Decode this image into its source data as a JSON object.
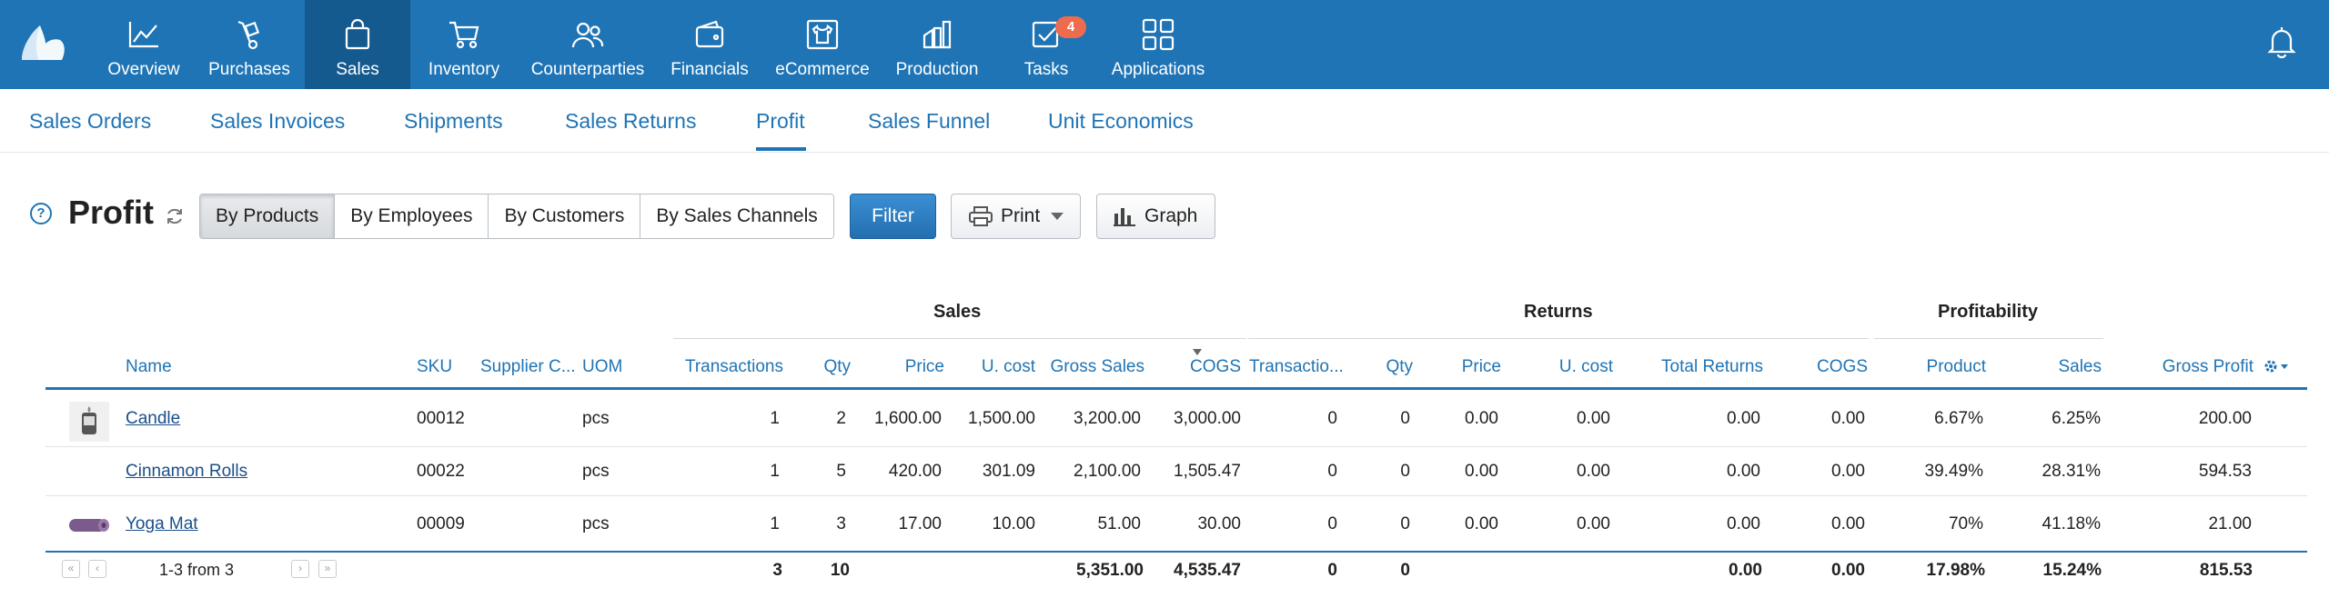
{
  "nav": {
    "items": [
      {
        "label": "Overview",
        "icon": "chart-line-icon"
      },
      {
        "label": "Purchases",
        "icon": "hand-truck-icon"
      },
      {
        "label": "Sales",
        "icon": "shopping-bag-icon",
        "active": true
      },
      {
        "label": "Inventory",
        "icon": "cart-icon"
      },
      {
        "label": "Counterparties",
        "icon": "people-icon"
      },
      {
        "label": "Financials",
        "icon": "wallet-icon"
      },
      {
        "label": "eCommerce",
        "icon": "shirt-icon"
      },
      {
        "label": "Production",
        "icon": "factory-icon"
      },
      {
        "label": "Tasks",
        "icon": "checkbox-icon",
        "badge": "4"
      },
      {
        "label": "Applications",
        "icon": "apps-grid-icon"
      }
    ]
  },
  "subnav": {
    "tabs": [
      {
        "label": "Sales Orders"
      },
      {
        "label": "Sales Invoices"
      },
      {
        "label": "Shipments"
      },
      {
        "label": "Sales Returns"
      },
      {
        "label": "Profit",
        "active": true
      },
      {
        "label": "Sales Funnel"
      },
      {
        "label": "Unit Economics"
      }
    ]
  },
  "page": {
    "help": "?",
    "title": "Profit",
    "segments": [
      "By Products",
      "By Employees",
      "By Customers",
      "By Sales Channels"
    ],
    "filter": "Filter",
    "print": "Print",
    "graph": "Graph"
  },
  "table": {
    "groups": {
      "sales": "Sales",
      "returns": "Returns",
      "profitability": "Profitability"
    },
    "columns": {
      "name": "Name",
      "sku": "SKU",
      "supplier": "Supplier C...",
      "uom": "UOM",
      "s_trans": "Transactions",
      "s_qty": "Qty",
      "s_price": "Price",
      "s_ucost": "U. cost",
      "s_gross": "Gross Sales",
      "s_cogs": "COGS",
      "r_trans": "Transactio...",
      "r_qty": "Qty",
      "r_price": "Price",
      "r_ucost": "U. cost",
      "r_total": "Total Returns",
      "r_cogs": "COGS",
      "p_product": "Product",
      "p_sales": "Sales",
      "p_gross": "Gross Profit"
    },
    "rows": [
      {
        "name": "Candle",
        "sku": "00012",
        "uom": "pcs",
        "s_trans": "1",
        "s_qty": "2",
        "s_price": "1,600.00",
        "s_ucost": "1,500.00",
        "s_gross": "3,200.00",
        "s_cogs": "3,000.00",
        "r_trans": "0",
        "r_qty": "0",
        "r_price": "0.00",
        "r_ucost": "0.00",
        "r_total": "0.00",
        "r_cogs": "0.00",
        "p_product": "6.67%",
        "p_sales": "6.25%",
        "p_gross": "200.00"
      },
      {
        "name": "Cinnamon Rolls",
        "sku": "00022",
        "uom": "pcs",
        "s_trans": "1",
        "s_qty": "5",
        "s_price": "420.00",
        "s_ucost": "301.09",
        "s_gross": "2,100.00",
        "s_cogs": "1,505.47",
        "r_trans": "0",
        "r_qty": "0",
        "r_price": "0.00",
        "r_ucost": "0.00",
        "r_total": "0.00",
        "r_cogs": "0.00",
        "p_product": "39.49%",
        "p_sales": "28.31%",
        "p_gross": "594.53"
      },
      {
        "name": "Yoga Mat",
        "sku": "00009",
        "uom": "pcs",
        "s_trans": "1",
        "s_qty": "3",
        "s_price": "17.00",
        "s_ucost": "10.00",
        "s_gross": "51.00",
        "s_cogs": "30.00",
        "r_trans": "0",
        "r_qty": "0",
        "r_price": "0.00",
        "r_ucost": "0.00",
        "r_total": "0.00",
        "r_cogs": "0.00",
        "p_product": "70%",
        "p_sales": "41.18%",
        "p_gross": "21.00"
      }
    ],
    "totals": {
      "pager": "1-3 from 3",
      "s_trans": "3",
      "s_qty": "10",
      "s_gross": "5,351.00",
      "s_cogs": "4,535.47",
      "r_trans": "0",
      "r_qty": "0",
      "r_total": "0.00",
      "r_cogs": "0.00",
      "p_product": "17.98%",
      "p_sales": "15.24%",
      "p_gross": "815.53"
    }
  },
  "colors": {
    "brand": "#1f74b5",
    "active_nav": "#155a8f",
    "badge": "#ee6b4d"
  }
}
